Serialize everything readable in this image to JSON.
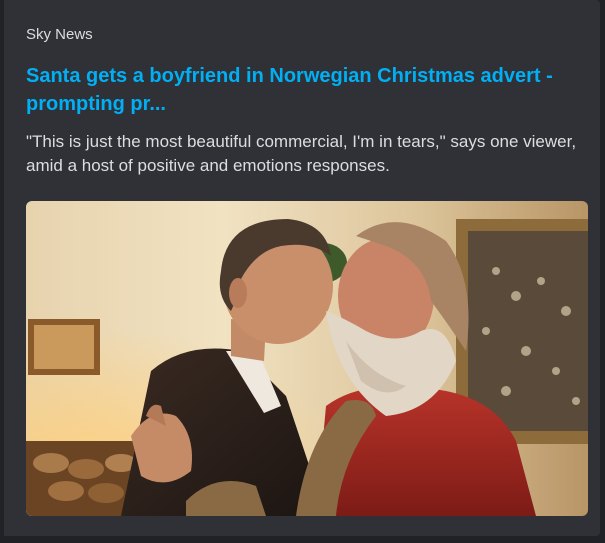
{
  "embed": {
    "provider": "Sky News",
    "title": "Santa gets a boyfriend in Norwegian Christmas advert - prompting pr...",
    "description": "\"This is just the most beautiful commercial, I'm in tears,\" says one viewer, amid a host of positive and emotions responses."
  },
  "colors": {
    "link": "#00aff4",
    "background": "#2f3136",
    "text": "#dcddde"
  }
}
